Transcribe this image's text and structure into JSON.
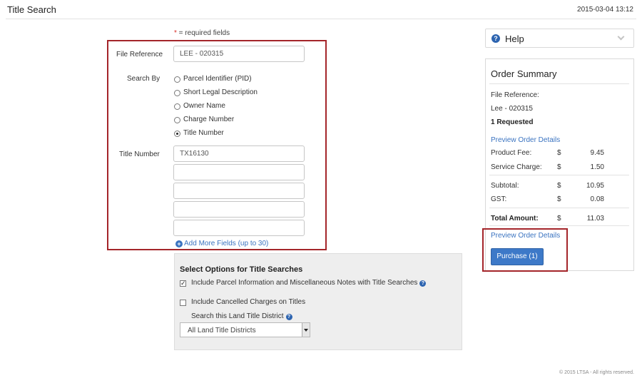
{
  "header": {
    "title": "Title Search",
    "timestamp": "2015-03-04 13:12"
  },
  "form": {
    "required_star": "*",
    "required_note": " = required fields",
    "file_reference_label": "File Reference",
    "file_reference_value": "LEE - 020315",
    "search_by_label": "Search By",
    "search_by_options": [
      "Parcel Identifier (PID)",
      "Short Legal Description",
      "Owner Name",
      "Charge Number",
      "Title Number"
    ],
    "search_by_selected": "Title Number",
    "title_number_label": "Title Number",
    "title_number_values": [
      "TX16130",
      "",
      "",
      "",
      ""
    ],
    "add_more_label": "Add More Fields (up to 30)"
  },
  "options": {
    "title": "Select Options for Title Searches",
    "include_parcel_label": "Include Parcel Information and Miscellaneous Notes with Title Searches",
    "include_parcel_checked": true,
    "include_cancelled_label": "Include Cancelled Charges on Titles",
    "include_cancelled_checked": false,
    "district_label": "Search this Land Title District",
    "district_value": "All Land Title Districts"
  },
  "help": {
    "label": "Help"
  },
  "summary": {
    "title": "Order Summary",
    "file_reference_label": "File Reference:",
    "file_reference_value": "Lee - 020315",
    "requested": "1 Requested",
    "preview_link": "Preview Order Details",
    "currency": "$",
    "product_fee_label": "Product Fee:",
    "product_fee": "9.45",
    "service_charge_label": "Service Charge:",
    "service_charge": "1.50",
    "subtotal_label": "Subtotal:",
    "subtotal": "10.95",
    "gst_label": "GST:",
    "gst": "0.08",
    "total_label": "Total Amount:",
    "total": "11.03",
    "preview_link_bottom": "Preview Order Details",
    "purchase_label": "Purchase (1)"
  },
  "footer": {
    "copyright": "© 2015 LTSA - All rights reserved."
  },
  "colors": {
    "accent": "#3d79c8",
    "highlight_border": "#a4252a",
    "link": "#3a73c0",
    "required": "#d9302a"
  }
}
